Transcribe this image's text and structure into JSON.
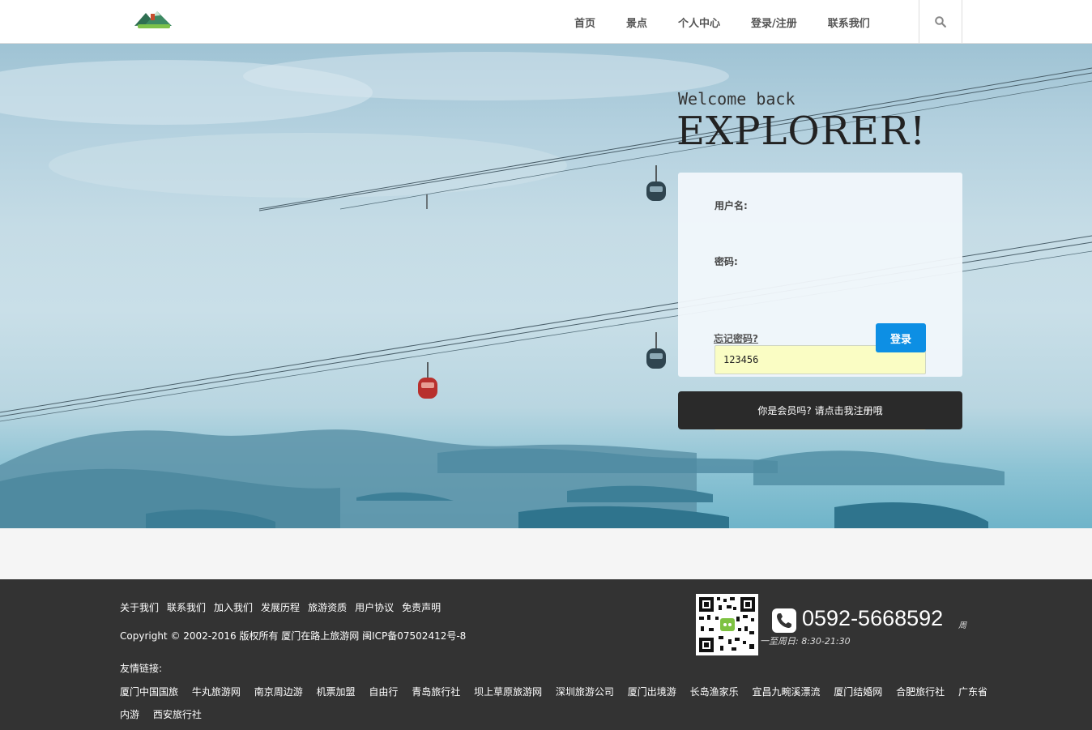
{
  "nav": {
    "items": [
      "首页",
      "景点",
      "个人中心",
      "登录/注册",
      "联系我们"
    ]
  },
  "hero": {
    "welcome": "Welcome back",
    "title": "EXPLORER!"
  },
  "login": {
    "username_label": "用户名:",
    "username_value": "123456",
    "password_label": "密码:",
    "password_value": "••••••",
    "forgot_label": "忘记密码?",
    "submit_label": "登录",
    "register_label": "你是会员吗? 请点击我注册哦"
  },
  "footer": {
    "links": [
      "关于我们",
      "联系我们",
      "加入我们",
      "发展历程",
      "旅游资质",
      "用户协议",
      "免责声明"
    ],
    "copyright": "Copyright © 2002-2016  版权所有  厦门在路上旅游网    闽ICP备07502412号-8",
    "friend_title": "友情链接:",
    "friend_links": [
      "厦门中国国旅",
      "牛丸旅游网",
      "南京周边游",
      "机票加盟",
      "自由行",
      "青岛旅行社",
      "坝上草原旅游网",
      "深圳旅游公司",
      "厦门出境游",
      "长岛渔家乐",
      "宜昌九畹溪漂流",
      "厦门结婚网",
      "合肥旅行社",
      "广东省内游",
      "西安旅行社"
    ],
    "phone": "0592-5668592",
    "hours_a": "周",
    "hours_b": "一至周日:  8:30-21:30"
  },
  "colors": {
    "accent": "#0d8fe4",
    "footer_bg": "#333333",
    "field_bg": "#fafdc4"
  }
}
